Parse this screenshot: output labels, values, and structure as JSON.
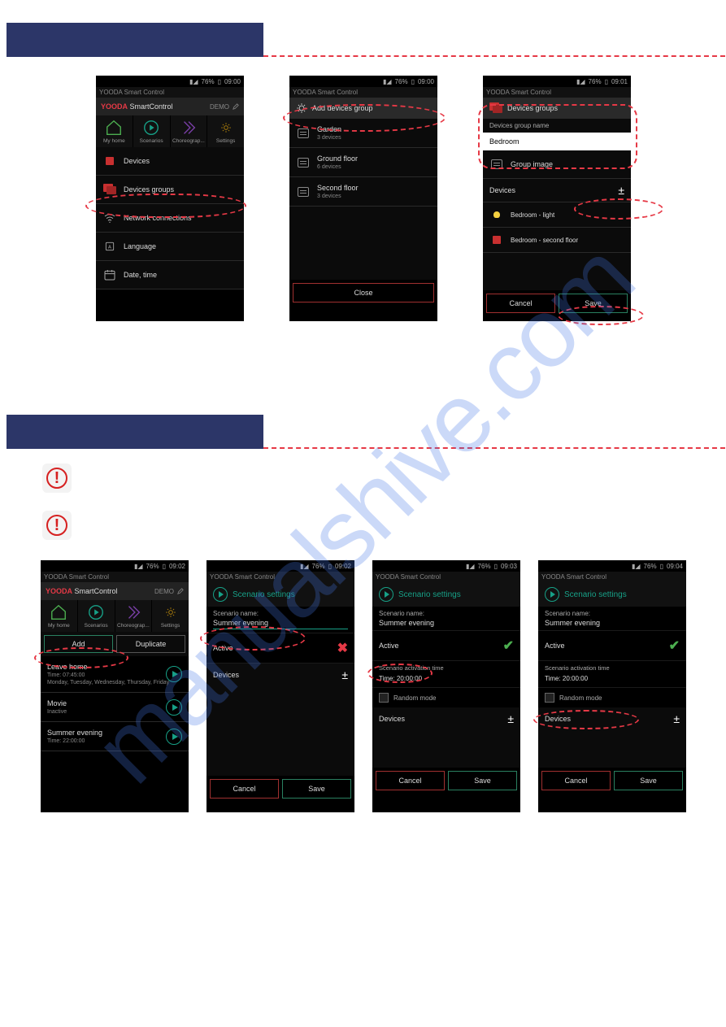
{
  "watermark": "manualshive.com",
  "status": {
    "battery": "76%",
    "time": "09:00",
    "time2": "09:01",
    "time3": "09:02",
    "time4": "09:02",
    "time5": "09:03",
    "time6": "09:04"
  },
  "app_title": "YOODA Smart Control",
  "brand_prefix": "YOODA",
  "brand_suffix": "SmartControl",
  "demo": "DEMO",
  "tabs": {
    "home": "My home",
    "scenarios": "Scenarios",
    "choreo": "Choreograp...",
    "settings": "Settings"
  },
  "settings_menu": {
    "devices": "Devices",
    "devices_groups": "Devices groups",
    "network": "Network connections",
    "language": "Language",
    "datetime": "Date, time"
  },
  "add_group_screen": {
    "header": "Add devices group",
    "groups": [
      {
        "name": "Garden",
        "sub": "3 devices"
      },
      {
        "name": "Ground floor",
        "sub": "6 devices"
      },
      {
        "name": "Second floor",
        "sub": "3 devices"
      }
    ],
    "close": "Close"
  },
  "edit_group_screen": {
    "header": "Devices groups",
    "name_label": "Devices group name",
    "name_value": "Bedroom",
    "image_label": "Group image",
    "devices_label": "Devices",
    "items": [
      {
        "name": "Bedroom - light",
        "type": "bulb"
      },
      {
        "name": "Bedroom - second floor",
        "type": "blind"
      }
    ],
    "cancel": "Cancel",
    "save": "Save"
  },
  "scenarios_list": {
    "add": "Add",
    "duplicate": "Duplicate",
    "items": [
      {
        "name": "Leave home",
        "sub1": "Time: 07:45:00",
        "sub2": "Monday, Tuesday, Wednesday, Thursday, Friday"
      },
      {
        "name": "Movie",
        "sub1": "Inactive",
        "sub2": ""
      },
      {
        "name": "Summer evening",
        "sub1": "Time: 22:00:00",
        "sub2": ""
      }
    ]
  },
  "scenario_settings": {
    "header": "Scenario settings",
    "name_label": "Scenario name:",
    "name_value": "Summer evening",
    "active": "Active",
    "devices": "Devices",
    "activation_time_label": "Scenario activation time",
    "activation_time_value": "Time: 20:00:00",
    "random": "Random mode",
    "cancel": "Cancel",
    "save": "Save"
  }
}
